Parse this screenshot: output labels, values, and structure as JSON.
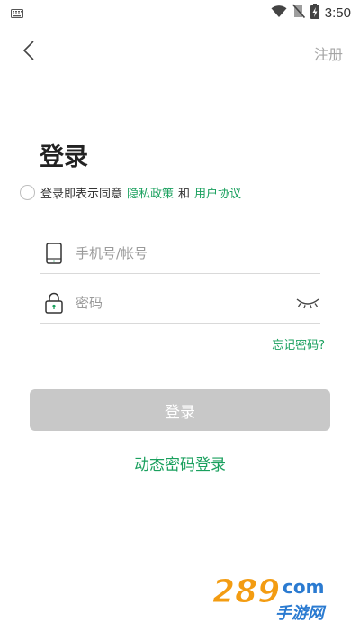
{
  "status_bar": {
    "time": "3:50",
    "icons": [
      "keyboard-icon",
      "wifi-icon",
      "no-sim-icon",
      "battery-charging-icon"
    ]
  },
  "header": {
    "back_icon": "chevron-left-icon",
    "register_label": "注册"
  },
  "title": "登录",
  "agreement": {
    "prefix": "登录即表示同意",
    "privacy_label": "隐私政策",
    "and_label": "和",
    "terms_label": "用户协议"
  },
  "phone_field": {
    "placeholder": "手机号/帐号",
    "value": "",
    "icon": "phone-icon"
  },
  "password_field": {
    "placeholder": "密码",
    "value": "",
    "icon": "lock-icon",
    "toggle_icon": "eye-closed-icon"
  },
  "forgot_label": "忘记密码?",
  "login_button_label": "登录",
  "dynamic_login_label": "动态密码登录",
  "watermark": {
    "number": "289",
    "domain": "com",
    "text": "手游网"
  },
  "colors": {
    "accent": "#1aa05e",
    "button_disabled": "#c8c8c8",
    "muted": "#a6a6a6"
  }
}
